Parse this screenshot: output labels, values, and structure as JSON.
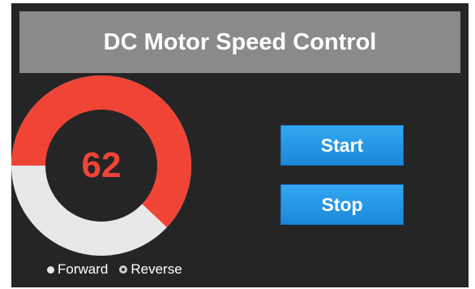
{
  "header": {
    "title": "DC Motor Speed Control"
  },
  "gauge": {
    "value": 62,
    "display_value": "62",
    "max": 100,
    "fill_color": "#f04437",
    "track_color": "#e8e8e8",
    "value_color": "#f04437",
    "center_color": "#252525"
  },
  "legend": {
    "forward_label": "Forward",
    "reverse_label": "Reverse"
  },
  "controls": {
    "start_label": "Start",
    "stop_label": "Stop"
  }
}
